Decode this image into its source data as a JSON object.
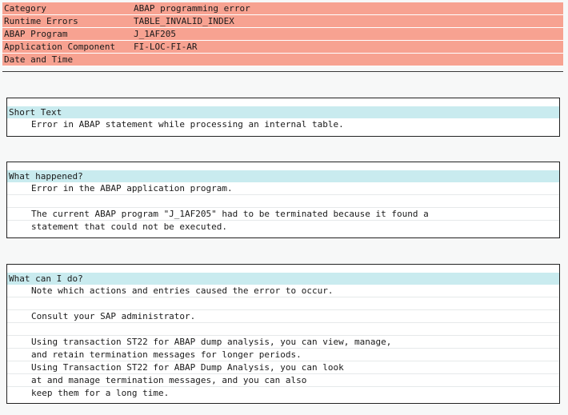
{
  "header": {
    "rows": [
      {
        "label": "Category",
        "value": "ABAP programming error"
      },
      {
        "label": "Runtime Errors",
        "value": "TABLE_INVALID_INDEX"
      },
      {
        "label": "ABAP Program",
        "value": "J_1AF205"
      },
      {
        "label": "Application Component",
        "value": "FI-LOC-FI-AR"
      },
      {
        "label": "Date and Time",
        "value": ""
      }
    ]
  },
  "sections": {
    "short_text": {
      "title": "Short Text",
      "lines": [
        "Error in ABAP statement while processing an internal table."
      ]
    },
    "what_happened": {
      "title": "What happened?",
      "lines": [
        "Error in the ABAP application program.",
        "",
        "The current ABAP program \"J_1AF205\" had to be terminated because it found a",
        "statement that could not be executed."
      ]
    },
    "what_can_i_do": {
      "title": "What can I do?",
      "lines": [
        "Note which actions and entries caused the error to occur.",
        "",
        "Consult your SAP administrator.",
        "",
        "Using transaction ST22 for ABAP dump analysis, you can view, manage,",
        "and retain termination messages for longer periods.",
        "Using Transaction ST22 for ABAP Dump Analysis, you can look",
        "at and manage termination messages, and you can also",
        "keep them for a long time."
      ]
    }
  },
  "colors": {
    "header_bg": "#f7a291",
    "section_title_bg": "#c9ebef"
  }
}
